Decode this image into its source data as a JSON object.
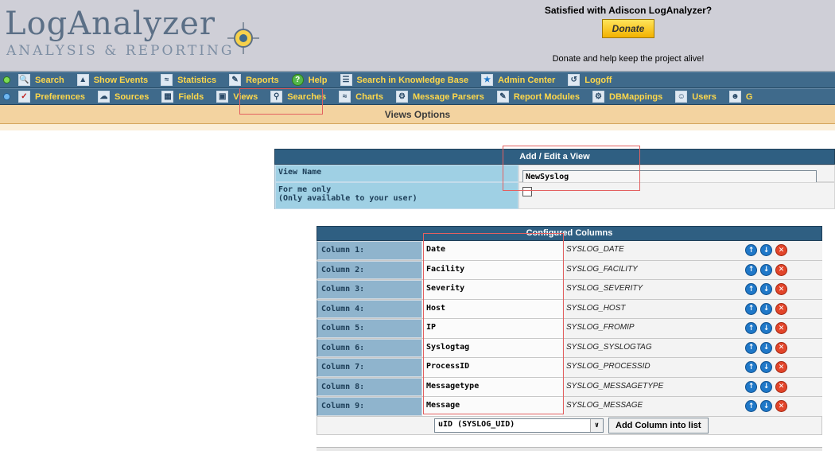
{
  "header": {
    "logo_title": "LogAnalyzer",
    "logo_subtitle": "ANALYSIS & REPORTING",
    "promo_title": "Satisfied with Adiscon LogAnalyzer?",
    "donate_label": "Donate",
    "promo_line": "Donate and help keep the project alive!"
  },
  "menu_main": [
    {
      "label": "Search",
      "icon": "magnifier-icon"
    },
    {
      "label": "Show Events",
      "icon": "events-icon"
    },
    {
      "label": "Statistics",
      "icon": "statistics-icon"
    },
    {
      "label": "Reports",
      "icon": "reports-icon"
    },
    {
      "label": "Help",
      "icon": "help-icon"
    },
    {
      "label": "Search in Knowledge Base",
      "icon": "knowledge-base-icon"
    },
    {
      "label": "Admin Center",
      "icon": "admin-star-icon"
    },
    {
      "label": "Logoff",
      "icon": "logoff-icon"
    }
  ],
  "menu_admin": [
    {
      "label": "Preferences",
      "icon": "preferences-icon"
    },
    {
      "label": "Sources",
      "icon": "sources-icon"
    },
    {
      "label": "Fields",
      "icon": "fields-icon"
    },
    {
      "label": "Views",
      "icon": "views-icon"
    },
    {
      "label": "Searches",
      "icon": "searches-icon"
    },
    {
      "label": "Charts",
      "icon": "charts-icon"
    },
    {
      "label": "Message Parsers",
      "icon": "parsers-icon"
    },
    {
      "label": "Report Modules",
      "icon": "report-modules-icon"
    },
    {
      "label": "DBMappings",
      "icon": "dbmappings-icon"
    },
    {
      "label": "Users",
      "icon": "users-icon"
    },
    {
      "label": "G",
      "icon": "groups-icon"
    }
  ],
  "subheader": "Views Options",
  "edit_view": {
    "header": "Add / Edit a View",
    "view_name_label": "View Name",
    "view_name_value": "NewSyslog",
    "for_me_only_label_1": "For me only",
    "for_me_only_label_2": "(Only available to your user)",
    "for_me_only_checked": false
  },
  "columns": {
    "header": "Configured Columns",
    "rows": [
      {
        "label": "Column 1:",
        "name": "Date",
        "field": "SYSLOG_DATE"
      },
      {
        "label": "Column 2:",
        "name": "Facility",
        "field": "SYSLOG_FACILITY"
      },
      {
        "label": "Column 3:",
        "name": "Severity",
        "field": "SYSLOG_SEVERITY"
      },
      {
        "label": "Column 4:",
        "name": "Host",
        "field": "SYSLOG_HOST"
      },
      {
        "label": "Column 5:",
        "name": "IP",
        "field": "SYSLOG_FROMIP"
      },
      {
        "label": "Column 6:",
        "name": "Syslogtag",
        "field": "SYSLOG_SYSLOGTAG"
      },
      {
        "label": "Column 7:",
        "name": "ProcessID",
        "field": "SYSLOG_PROCESSID"
      },
      {
        "label": "Column 8:",
        "name": "Messagetype",
        "field": "SYSLOG_MESSAGETYPE"
      },
      {
        "label": "Column 9:",
        "name": "Message",
        "field": "SYSLOG_MESSAGE"
      }
    ],
    "select_value": "uID (SYSLOG_UID)",
    "add_button_label": "Add Column into list"
  },
  "colors": {
    "menu_bg": "#3f6a8b",
    "menu_text": "#ffd84a",
    "label_bg": "#9fd0e4",
    "highlight": "#e36060"
  }
}
